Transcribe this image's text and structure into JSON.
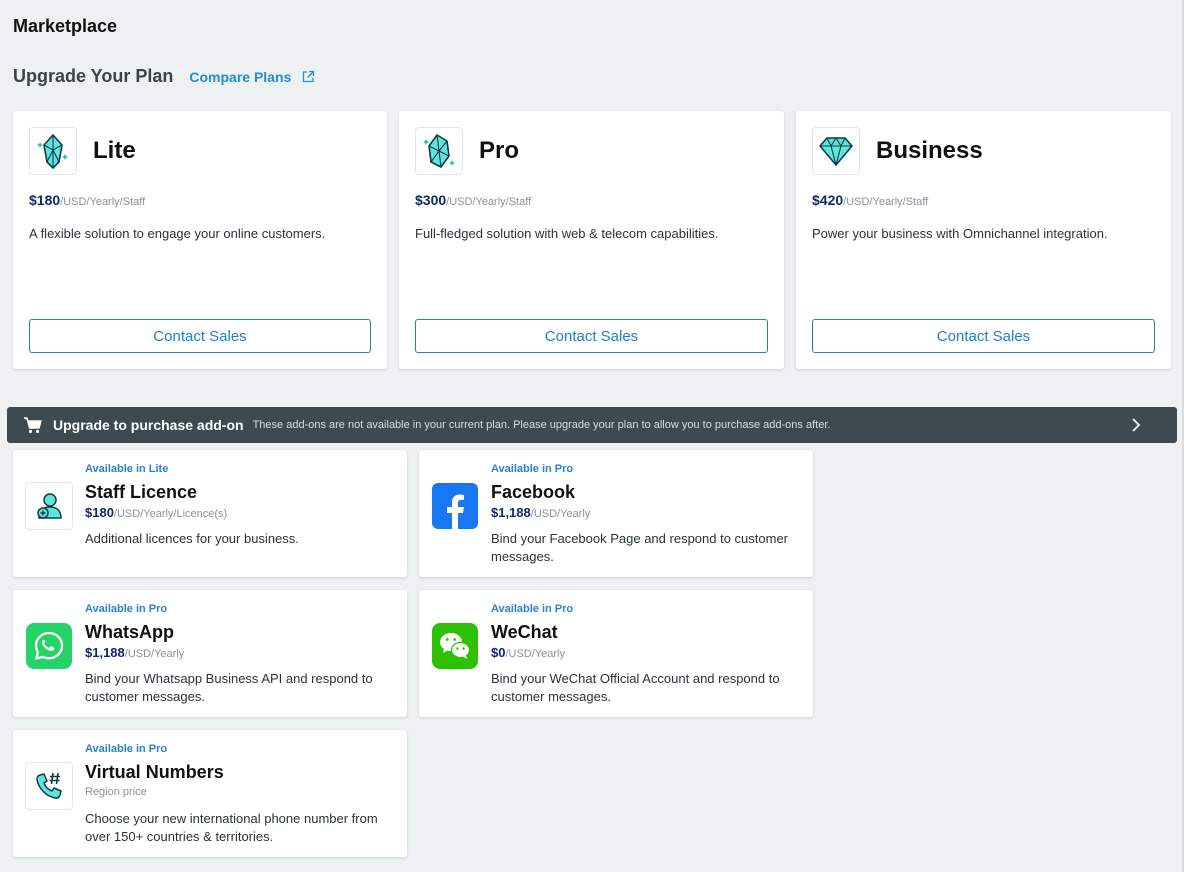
{
  "page": {
    "title": "Marketplace"
  },
  "plans_section": {
    "title": "Upgrade Your Plan",
    "compare_label": "Compare Plans"
  },
  "plans": [
    {
      "name": "Lite",
      "price": "$180",
      "unit": "/USD/Yearly/Staff",
      "description": "A flexible solution to engage your online customers.",
      "button": "Contact Sales",
      "icon": "gem-lite-icon"
    },
    {
      "name": "Pro",
      "price": "$300",
      "unit": "/USD/Yearly/Staff",
      "description": "Full-fledged solution with web & telecom capabilities.",
      "button": "Contact Sales",
      "icon": "gem-pro-icon"
    },
    {
      "name": "Business",
      "price": "$420",
      "unit": "/USD/Yearly/Staff",
      "description": "Power your business with Omnichannel integration.",
      "button": "Contact Sales",
      "icon": "diamond-icon"
    }
  ],
  "addon_banner": {
    "title": "Upgrade to purchase add-on",
    "note": "These add-ons are not available in your current plan. Please upgrade your plan to allow you to purchase add-ons after."
  },
  "addons": [
    {
      "availability": "Available in Lite",
      "name": "Staff Licence",
      "price": "$180",
      "unit": "/USD/Yearly/Licence(s)",
      "description": "Additional licences for your business.",
      "icon": "staff-licence-icon"
    },
    {
      "availability": "Available in Pro",
      "name": "Facebook",
      "price": "$1,188",
      "unit": "/USD/Yearly",
      "description": "Bind your Facebook Page and respond to customer messages.",
      "icon": "facebook-icon"
    },
    {
      "availability": "Available in Pro",
      "name": "WhatsApp",
      "price": "$1,188",
      "unit": "/USD/Yearly",
      "description": "Bind your Whatsapp Business API and respond to customer messages.",
      "icon": "whatsapp-icon"
    },
    {
      "availability": "Available in Pro",
      "name": "WeChat",
      "price": "$0",
      "unit": "/USD/Yearly",
      "description": "Bind your WeChat Official Account and respond to customer messages.",
      "icon": "wechat-icon"
    },
    {
      "availability": "Available in Pro",
      "name": "Virtual Numbers",
      "region_price": "Region price",
      "description": "Choose your new international phone number from over 150+ countries & territories.",
      "icon": "virtual-number-icon"
    }
  ],
  "colors": {
    "background": "#edf1f2",
    "accent": "#1f7fc6",
    "link": "#1f8fd0",
    "price": "#0d2a6b",
    "banner": "#3e4a4f",
    "facebook": "#1877f2",
    "whatsapp": "#25d366",
    "wechat": "#2dc100"
  }
}
